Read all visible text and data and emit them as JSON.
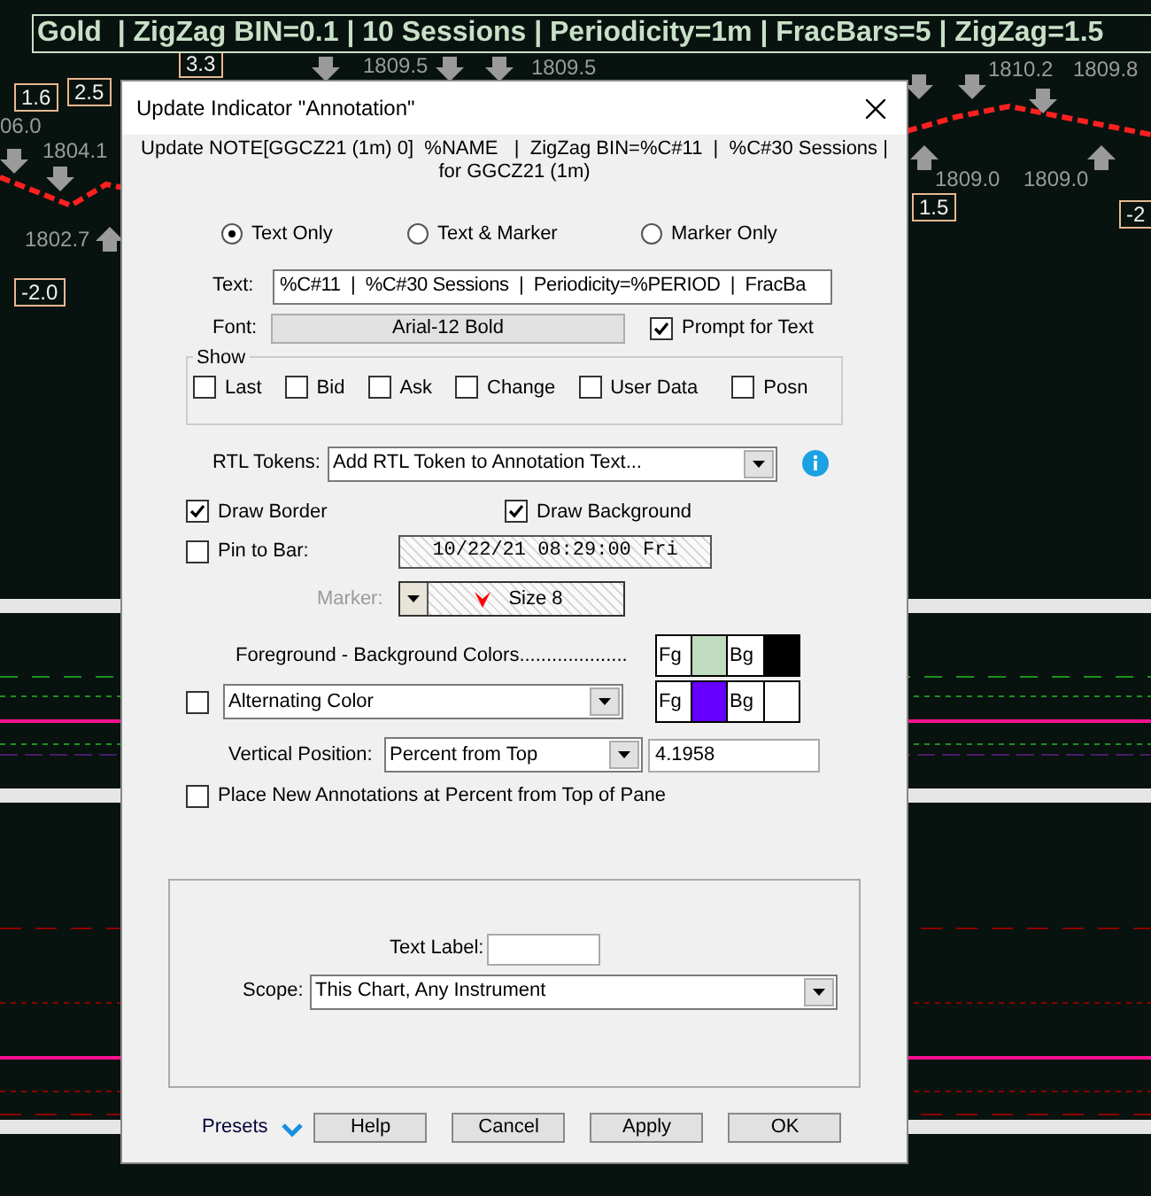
{
  "chart": {
    "banner": "Gold  | ZigZag BIN=0.1 | 10 Sessions | Periodicity=1m | FracBars=5 | ZigZag=1.5",
    "labels": [
      {
        "text": "1.6",
        "kind": "boxed"
      },
      {
        "text": "2.5",
        "kind": "boxed"
      },
      {
        "text": "3.3",
        "kind": "boxed"
      },
      {
        "text": "-2.0",
        "kind": "boxed"
      },
      {
        "text": "1.5",
        "kind": "boxed"
      },
      {
        "text": "-2",
        "kind": "boxed"
      },
      {
        "text": "06.0",
        "kind": "price"
      },
      {
        "text": "1804.1",
        "kind": "price"
      },
      {
        "text": "1802.7",
        "kind": "price"
      },
      {
        "text": "1809.5",
        "kind": "price"
      },
      {
        "text": "1809.5",
        "kind": "price"
      },
      {
        "text": "1810.2",
        "kind": "price"
      },
      {
        "text": "1809.8",
        "kind": "price"
      },
      {
        "text": "1809.0",
        "kind": "price"
      },
      {
        "text": "1809.0",
        "kind": "price"
      }
    ]
  },
  "dialog": {
    "title": "Update Indicator \"Annotation\"",
    "subtitle": "Update NOTE[GGCZ21 (1m) 0]  %NAME   |  ZigZag BIN=%C#11  |  %C#30 Sessions |   for GGCZ21 (1m)",
    "mode_options": [
      {
        "label": "Text Only",
        "selected": true
      },
      {
        "label": "Text & Marker",
        "selected": false
      },
      {
        "label": "Marker Only",
        "selected": false
      }
    ],
    "text_field": {
      "label": "Text:",
      "value": "%C#11  |  %C#30 Sessions  |  Periodicity=%PERIOD  |  FracBa"
    },
    "font": {
      "label": "Font:",
      "value": "Arial-12 Bold"
    },
    "prompt_for_text": {
      "label": "Prompt for Text",
      "checked": true
    },
    "show": {
      "title": "Show",
      "items": [
        {
          "label": "Last",
          "checked": false
        },
        {
          "label": "Bid",
          "checked": false
        },
        {
          "label": "Ask",
          "checked": false
        },
        {
          "label": "Change",
          "checked": false
        },
        {
          "label": "User Data",
          "checked": false
        },
        {
          "label": "Posn",
          "checked": false
        }
      ]
    },
    "rtl_tokens": {
      "label": "RTL Tokens:",
      "value": "Add RTL Token to Annotation Text..."
    },
    "draw_border": {
      "label": "Draw Border",
      "checked": true
    },
    "draw_background": {
      "label": "Draw Background",
      "checked": true
    },
    "pin_to_bar": {
      "label": "Pin to Bar:",
      "checked": false,
      "value": "10/22/21 08:29:00 Fri"
    },
    "marker": {
      "label": "Marker:",
      "value": "Size 8",
      "disabled": true
    },
    "colors": {
      "label": "Foreground - Background Colors....................",
      "swatches": [
        {
          "label": "Fg",
          "color": "#c0dcc0"
        },
        {
          "label": "Bg",
          "color": "#000000"
        }
      ]
    },
    "alternating": {
      "checked": false,
      "value": "Alternating Color",
      "swatches": [
        {
          "label": "Fg",
          "color": "#6600ff"
        },
        {
          "label": "Bg",
          "color": "#ffffff"
        }
      ]
    },
    "vertical_position": {
      "label": "Vertical Position:",
      "value": "Percent from Top",
      "number": "4.1958"
    },
    "place_new": {
      "label": "Place New Annotations at Percent from Top of Pane",
      "checked": false
    },
    "text_label": {
      "label": "Text Label:"
    },
    "scope": {
      "label": "Scope:",
      "value": "This Chart, Any Instrument"
    },
    "presets": "Presets",
    "buttons": [
      "Help",
      "Cancel",
      "Apply",
      "OK"
    ]
  }
}
